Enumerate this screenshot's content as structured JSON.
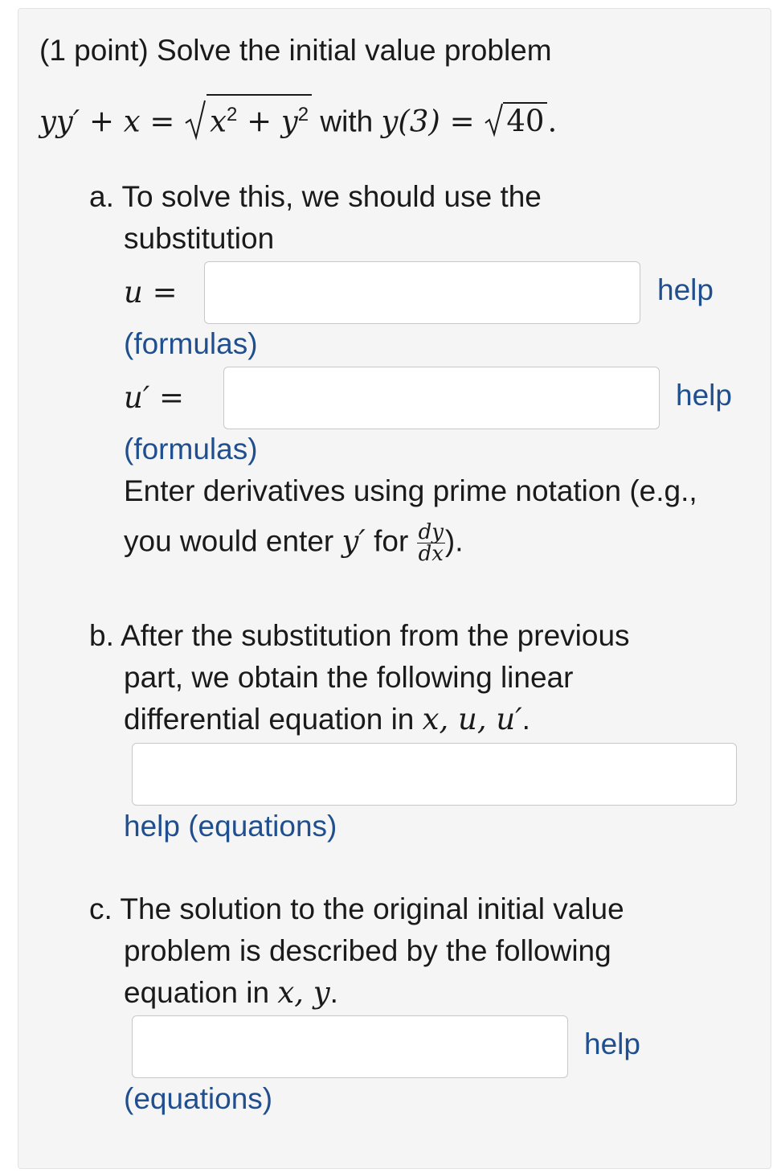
{
  "header": {
    "points": "(1 point) Solve the initial value problem",
    "eq_lhs": "yy′ + x = ",
    "eq_radicand_x": "x",
    "eq_radicand_plus": " + ",
    "eq_radicand_y": "y",
    "exp2": "2",
    "with_text": " with ",
    "ic_lhs": "y(3) = ",
    "ic_val": "40",
    "period": "."
  },
  "part_a": {
    "label": "a. To solve this, we should use the",
    "label2": "substitution",
    "u_label": "u =",
    "uprime_label": "u′ =",
    "help1": "help",
    "help2": "help",
    "formulas1": "(formulas)",
    "formulas2": "(formulas)",
    "note1": "Enter derivatives using prime notation (e.g.,",
    "note2_a": "you would enter ",
    "note2_y": "y′",
    "note2_b": " for ",
    "frac_num": "dy",
    "frac_den": "dx",
    "note2_end": ")."
  },
  "part_b": {
    "line1": "b. After the substitution from the previous",
    "line2": "part, we obtain the following linear",
    "line3_a": "differential equation in ",
    "line3_vars": "x, u, u′",
    "line3_end": ".",
    "help": "help (equations)"
  },
  "part_c": {
    "line1": "c. The solution to the original initial value",
    "line2": "problem is described by the following",
    "line3_a": "equation in ",
    "line3_vars": "x, y",
    "line3_end": ".",
    "help": "help",
    "equations": "(equations)"
  }
}
